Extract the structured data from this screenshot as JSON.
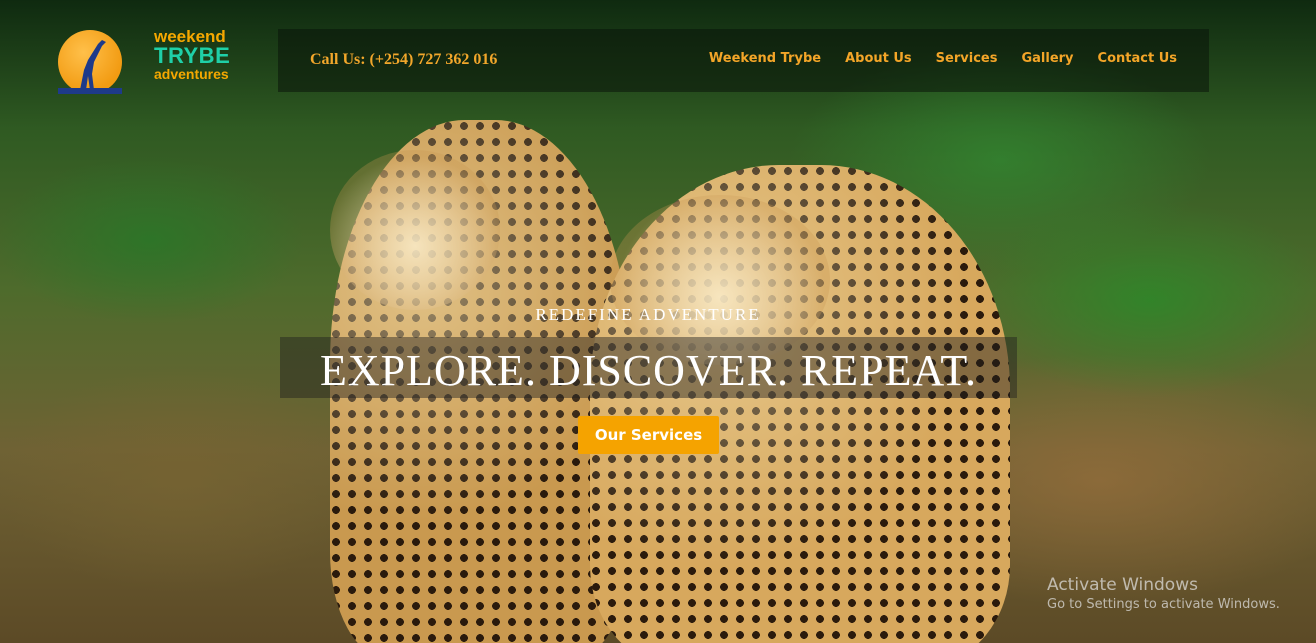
{
  "logo": {
    "line1": "weekend",
    "line2": "TRYBE",
    "line3": "adventures"
  },
  "header": {
    "call": "Call Us: (+254) 727 362 016",
    "nav": [
      {
        "label": "Weekend Trybe"
      },
      {
        "label": "About Us"
      },
      {
        "label": "Services"
      },
      {
        "label": "Gallery"
      },
      {
        "label": "Contact Us"
      }
    ]
  },
  "hero": {
    "subtitle": "REDEFINE ADVENTURE",
    "title": "EXPLORE. DISCOVER. REPEAT.",
    "cta": "Our Services"
  },
  "watermark": {
    "title": "Activate Windows",
    "subtitle": "Go to Settings to activate Windows."
  },
  "colors": {
    "accent": "#f5a300",
    "nav_text": "#f3a528",
    "logo_teal": "#1fd0a8"
  }
}
